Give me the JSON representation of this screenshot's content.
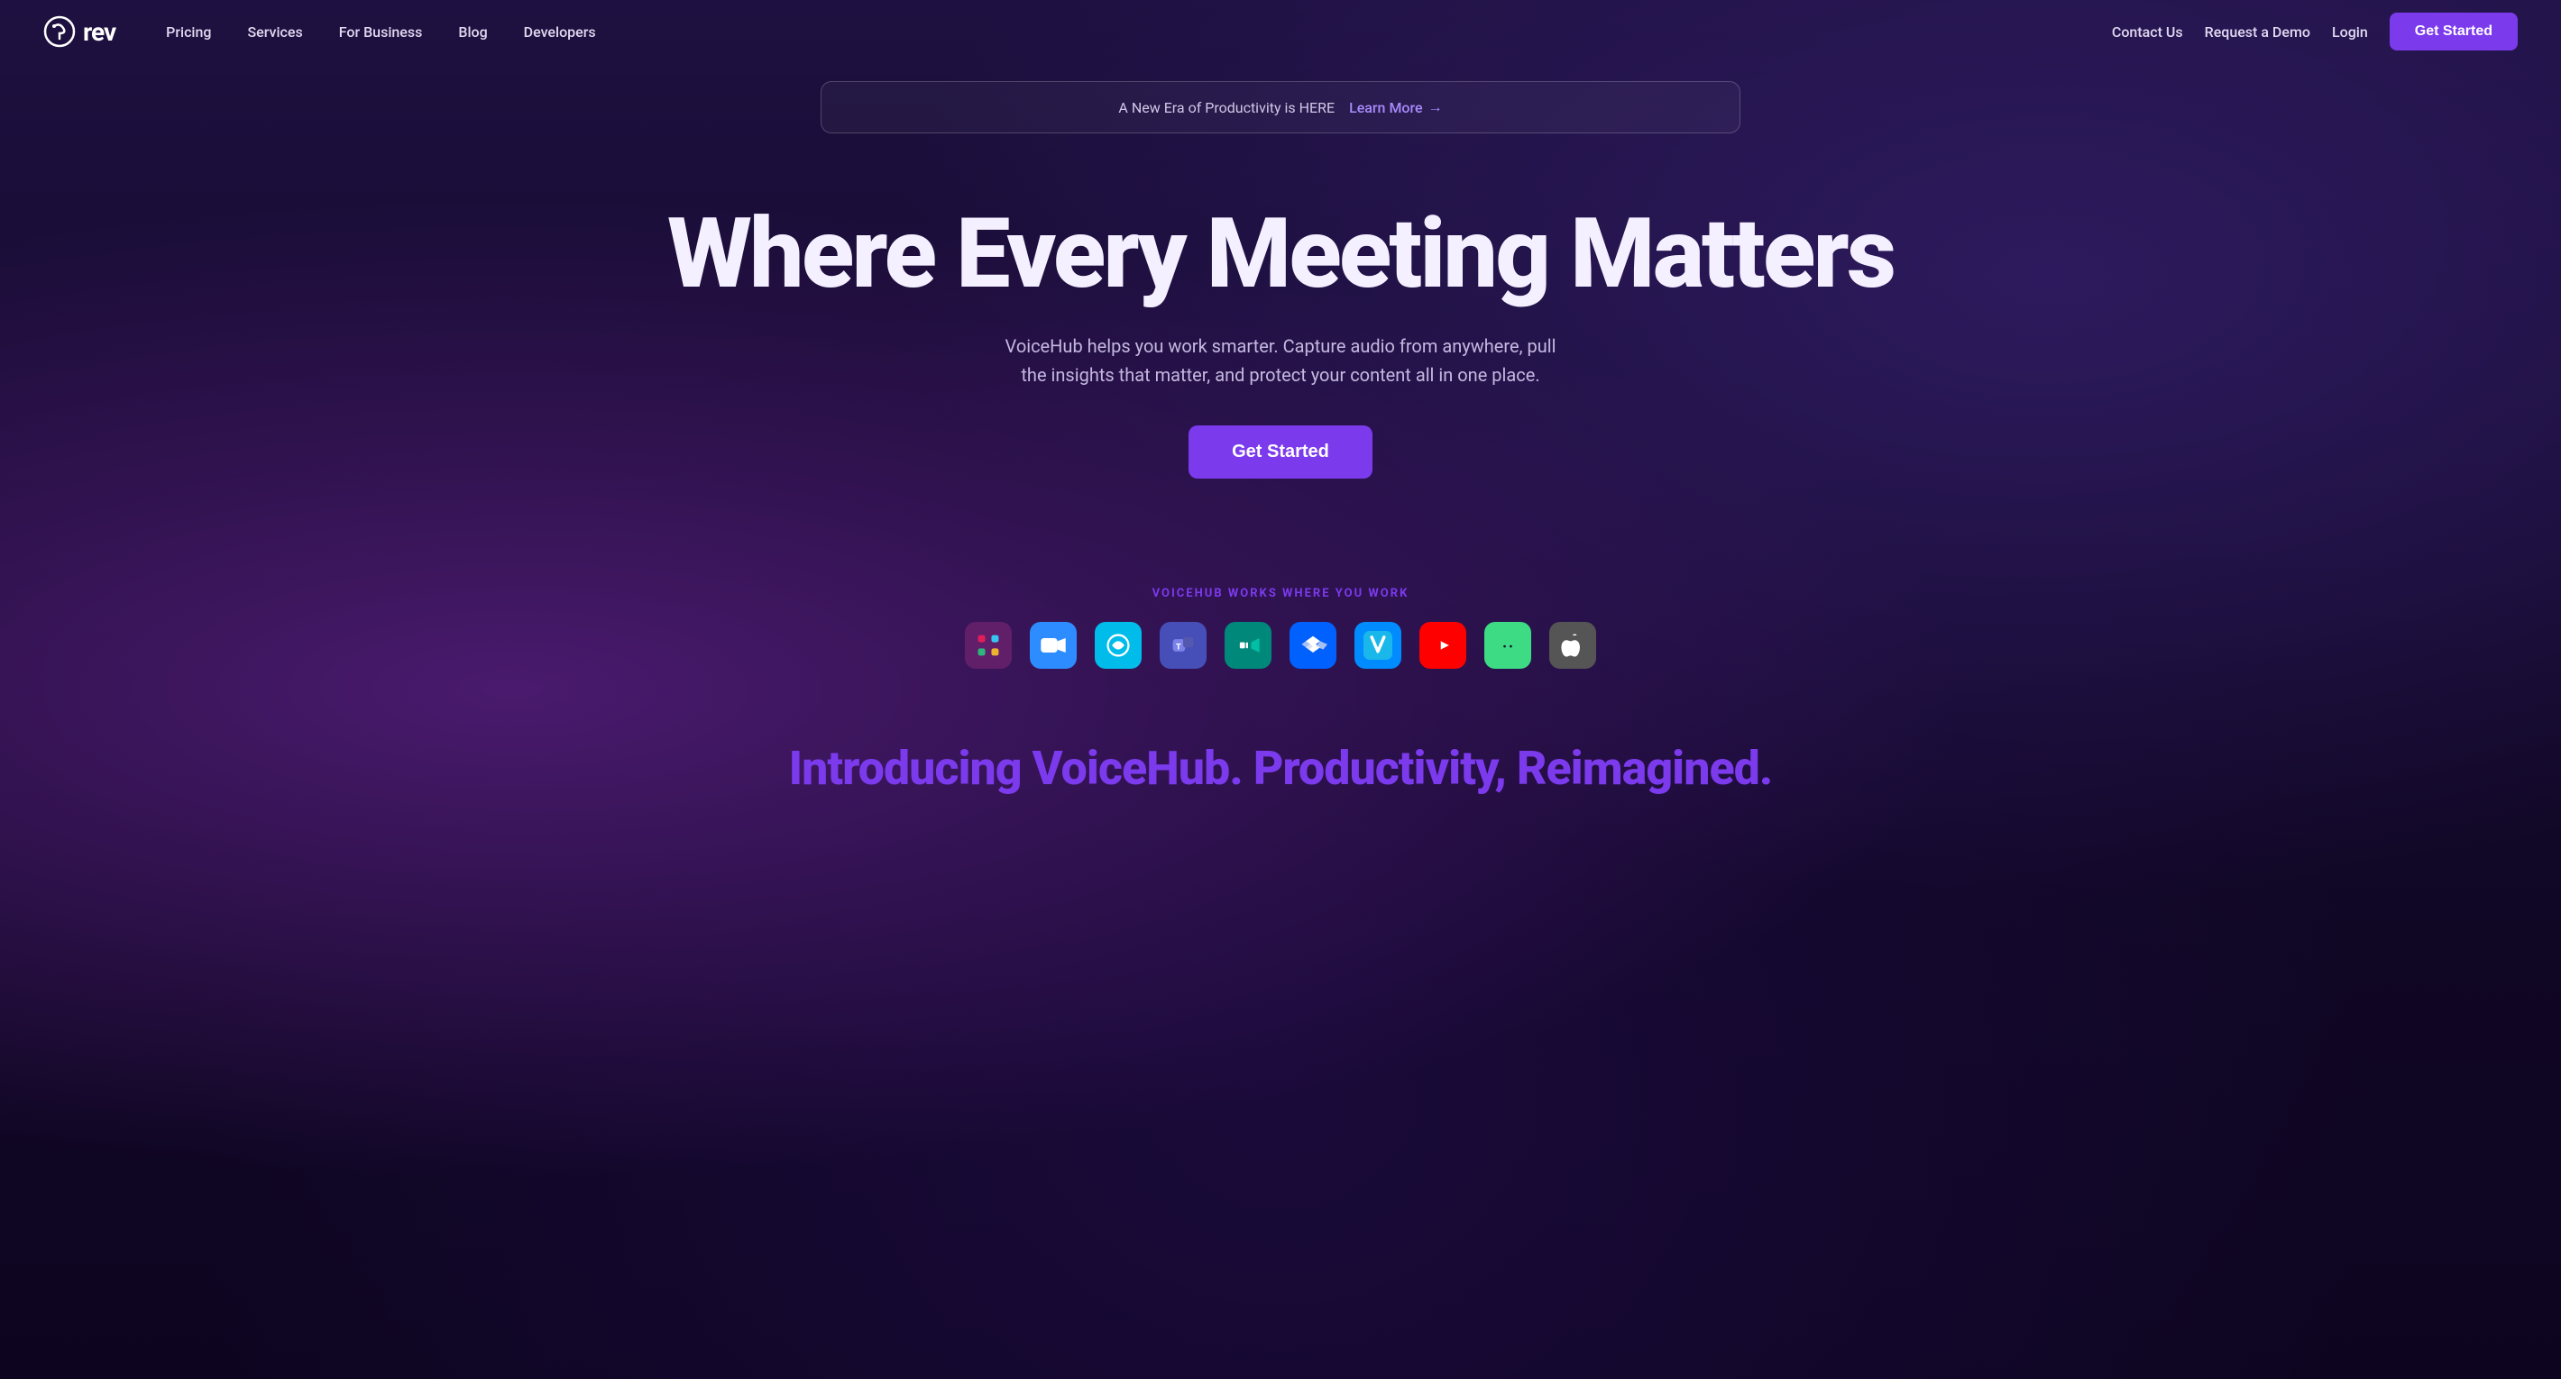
{
  "logo": {
    "text": "rev",
    "alt": "Rev logo"
  },
  "navbar": {
    "left_links": [
      {
        "label": "Pricing",
        "id": "pricing"
      },
      {
        "label": "Services",
        "id": "services"
      },
      {
        "label": "For Business",
        "id": "for-business"
      },
      {
        "label": "Blog",
        "id": "blog"
      },
      {
        "label": "Developers",
        "id": "developers"
      }
    ],
    "right_links": [
      {
        "label": "Contact Us",
        "id": "contact"
      },
      {
        "label": "Request a Demo",
        "id": "demo"
      },
      {
        "label": "Login",
        "id": "login"
      }
    ],
    "cta_label": "Get Started"
  },
  "announcement": {
    "text": "A New Era of Productivity is HERE",
    "link_text": "Learn More",
    "arrow": "→"
  },
  "hero": {
    "title": "Where Every Meeting Matters",
    "subtitle": "VoiceHub helps you work smarter. Capture audio from anywhere, pull the insights that matter, and protect your content all in one place.",
    "cta_label": "Get Started"
  },
  "integrations": {
    "label": "VOICEHUB WORKS WHERE YOU WORK",
    "icons": [
      {
        "name": "Slack",
        "id": "slack"
      },
      {
        "name": "Zoom",
        "id": "zoom"
      },
      {
        "name": "Webex",
        "id": "webex"
      },
      {
        "name": "Microsoft Teams",
        "id": "teams"
      },
      {
        "name": "Google Meet",
        "id": "meet"
      },
      {
        "name": "Dropbox",
        "id": "dropbox"
      },
      {
        "name": "Venmo",
        "id": "venmo"
      },
      {
        "name": "YouTube",
        "id": "youtube"
      },
      {
        "name": "Android",
        "id": "android"
      },
      {
        "name": "Apple",
        "id": "apple"
      }
    ]
  },
  "bottom": {
    "title": "Introducing VoiceHub. Productivity, Reimagined."
  },
  "colors": {
    "accent": "#7c3aed",
    "background": "#1a0d2e",
    "text_primary": "#f5f0ff",
    "text_secondary": "#c4b8e0"
  }
}
